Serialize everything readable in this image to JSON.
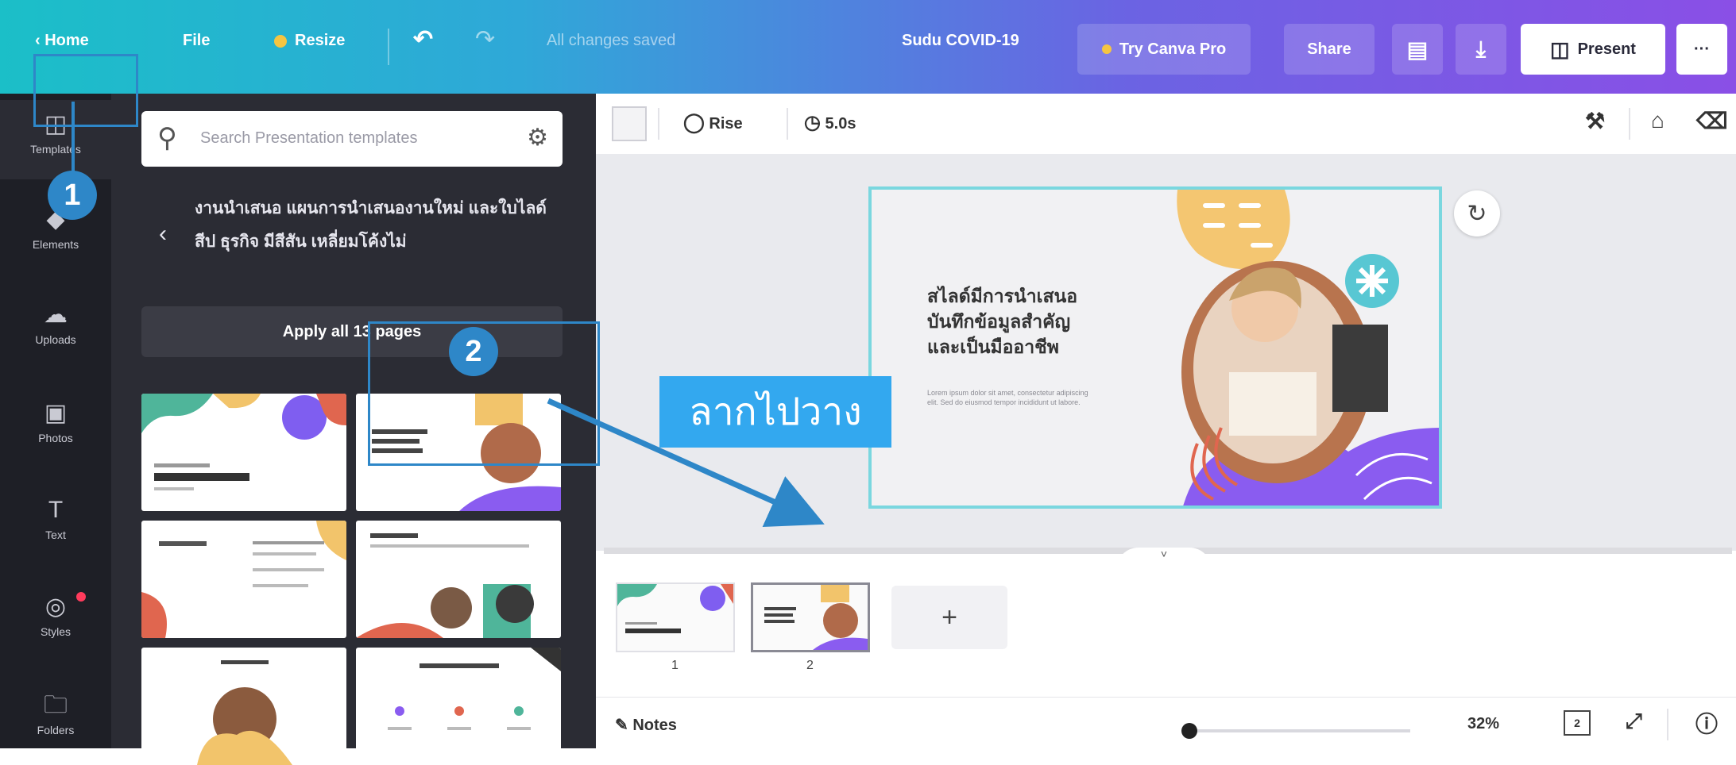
{
  "topbar": {
    "home": "Home",
    "file": "File",
    "resize": "Resize",
    "undo_icon": "undo-icon",
    "redo_icon": "redo-icon",
    "save_status": "All changes saved",
    "doc_title": "Sudu COVID-19",
    "try_pro": "Try Canva Pro",
    "share": "Share",
    "present": "Present",
    "more": "···"
  },
  "rail": {
    "items": [
      {
        "label": "Templates",
        "icon": "template-icon"
      },
      {
        "label": "Elements",
        "icon": "elements-icon"
      },
      {
        "label": "Uploads",
        "icon": "upload-icon"
      },
      {
        "label": "Photos",
        "icon": "photo-icon"
      },
      {
        "label": "Text",
        "icon": "text-icon"
      },
      {
        "label": "Styles",
        "icon": "styles-icon"
      },
      {
        "label": "Folders",
        "icon": "folder-icon"
      }
    ]
  },
  "panel": {
    "search_placeholder": "Search Presentation templates",
    "breadcrumb": "งานนำเสนอ แผนการนำเสนองานใหม่ และใบไลด์ สีป ธุรกิจ มีสีสัน เหลี่ยมโค้งไม่",
    "apply_all": "Apply all 13 pages"
  },
  "editor": {
    "fill_icon": "color-swatch",
    "animate": "Rise",
    "duration": "5.0s",
    "slide_title_lines": [
      "สไลด์มีการนำเสนอ",
      "บันทึกข้อมูลสำคัญ",
      "และเป็นมืออาชีพ"
    ],
    "slide_body": "Lorem ipsum dolor sit amet, consectetur adipiscing elit. Sed do eiusmod tempor incididunt ut labore.",
    "notes": "Notes",
    "zoom": "32%",
    "page_count": "2"
  },
  "pages": [
    {
      "number": "1"
    },
    {
      "number": "2"
    }
  ],
  "annotations": {
    "step1": "1",
    "step2": "2",
    "drag_label": "ลากไปวาง"
  },
  "colors": {
    "accent": "#2e87c8",
    "gradient_start": "#1bbfc8",
    "gradient_end": "#8a4fe6",
    "panel_bg": "#2b2c34",
    "rail_bg": "#1e1f26"
  }
}
